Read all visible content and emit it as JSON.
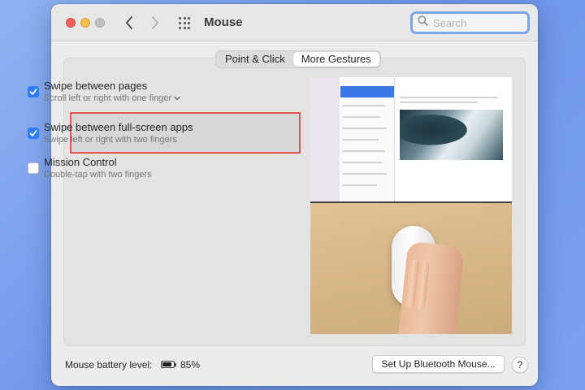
{
  "window": {
    "title": "Mouse"
  },
  "search": {
    "placeholder": "Search"
  },
  "tabs": [
    {
      "label": "Point & Click",
      "active": false
    },
    {
      "label": "More Gestures",
      "active": true
    }
  ],
  "options": [
    {
      "title": "Swipe between pages",
      "subtitle": "Scroll left or right with one finger",
      "checked": true,
      "has_dropdown": true
    },
    {
      "title": "Swipe between full-screen apps",
      "subtitle": "Swipe left or right with two fingers",
      "checked": true,
      "highlighted": true
    },
    {
      "title": "Mission Control",
      "subtitle": "Double-tap with two fingers",
      "checked": false
    }
  ],
  "footer": {
    "battery_label": "Mouse battery level:",
    "battery_value": "85%",
    "battery_level": 0.85,
    "bluetooth_button": "Set Up Bluetooth Mouse...",
    "help_label": "?"
  },
  "colors": {
    "accent": "#2f7cf6",
    "highlight_border": "#e2574c"
  },
  "icons": [
    "back-chevron-icon",
    "forward-chevron-icon",
    "grid-icon",
    "search-icon",
    "checkmark-icon",
    "chevron-down-icon",
    "battery-icon"
  ]
}
